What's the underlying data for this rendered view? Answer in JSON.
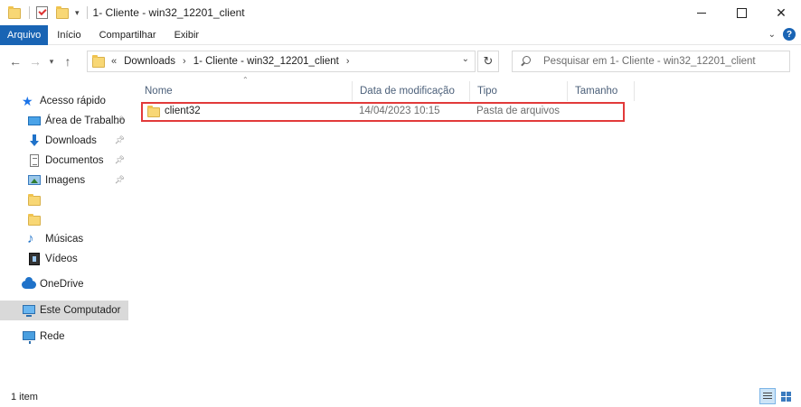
{
  "window": {
    "title": "1- Cliente - win32_12201_client",
    "minimize_glyph": "",
    "maximize_glyph": "",
    "close_glyph": "✕"
  },
  "ribbon": {
    "tabs": [
      "Arquivo",
      "Início",
      "Compartilhar",
      "Exibir"
    ]
  },
  "address": {
    "prefix": "«",
    "crumbs": [
      "Downloads",
      "1- Cliente - win32_12201_client"
    ],
    "separator": "›"
  },
  "search": {
    "placeholder": "Pesquisar em 1- Cliente - win32_12201_client"
  },
  "nav": {
    "quick_access": "Acesso rápido",
    "items": [
      {
        "label": "Área de Trabalho",
        "icon": "desktop-icon",
        "pinned": true
      },
      {
        "label": "Downloads",
        "icon": "download-icon",
        "pinned": true
      },
      {
        "label": "Documentos",
        "icon": "document-icon",
        "pinned": true
      },
      {
        "label": "Imagens",
        "icon": "pictures-icon",
        "pinned": true
      },
      {
        "label": "",
        "icon": "folder-icon",
        "pinned": false
      },
      {
        "label": "",
        "icon": "folder-icon",
        "pinned": false
      },
      {
        "label": "Músicas",
        "icon": "music-icon",
        "pinned": false
      },
      {
        "label": "Vídeos",
        "icon": "videos-icon",
        "pinned": false
      }
    ],
    "onedrive": "OneDrive",
    "this_pc": "Este Computador",
    "network": "Rede"
  },
  "columns": {
    "name": "Nome",
    "date": "Data de modificação",
    "type": "Tipo",
    "size": "Tamanho"
  },
  "files": [
    {
      "name": "client32",
      "date": "14/04/2023 10:15",
      "type": "Pasta de arquivos",
      "size": ""
    }
  ],
  "status": {
    "count": "1 item"
  },
  "colors": {
    "file_tab": "#1964b4",
    "highlight": "#e23a3a",
    "selected_nav": "#d9d9d9"
  }
}
